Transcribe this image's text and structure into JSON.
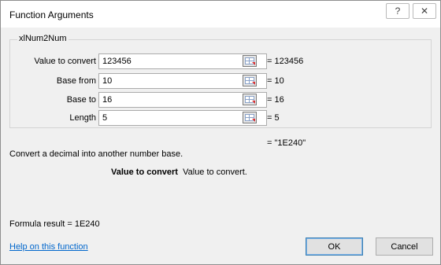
{
  "dialog": {
    "title": "Function Arguments",
    "help_glyph": "?",
    "close_glyph": "✕"
  },
  "function_group": {
    "name": "xlNum2Num",
    "arguments": [
      {
        "label": "Value to convert",
        "value": "123456",
        "result": "=  123456"
      },
      {
        "label": "Base from",
        "value": "10",
        "result": "=  10"
      },
      {
        "label": "Base to",
        "value": "16",
        "result": "=  16"
      },
      {
        "label": "Length",
        "value": "5",
        "result": "=  5"
      }
    ]
  },
  "overall_result": "=  \"1E240\"",
  "description": "Convert a decimal into another number base.",
  "argument_help": {
    "name": "Value to convert",
    "text": "Value to convert."
  },
  "formula_result": "Formula result =   1E240",
  "help_link": "Help on this function",
  "buttons": {
    "ok": "OK",
    "cancel": "Cancel"
  }
}
